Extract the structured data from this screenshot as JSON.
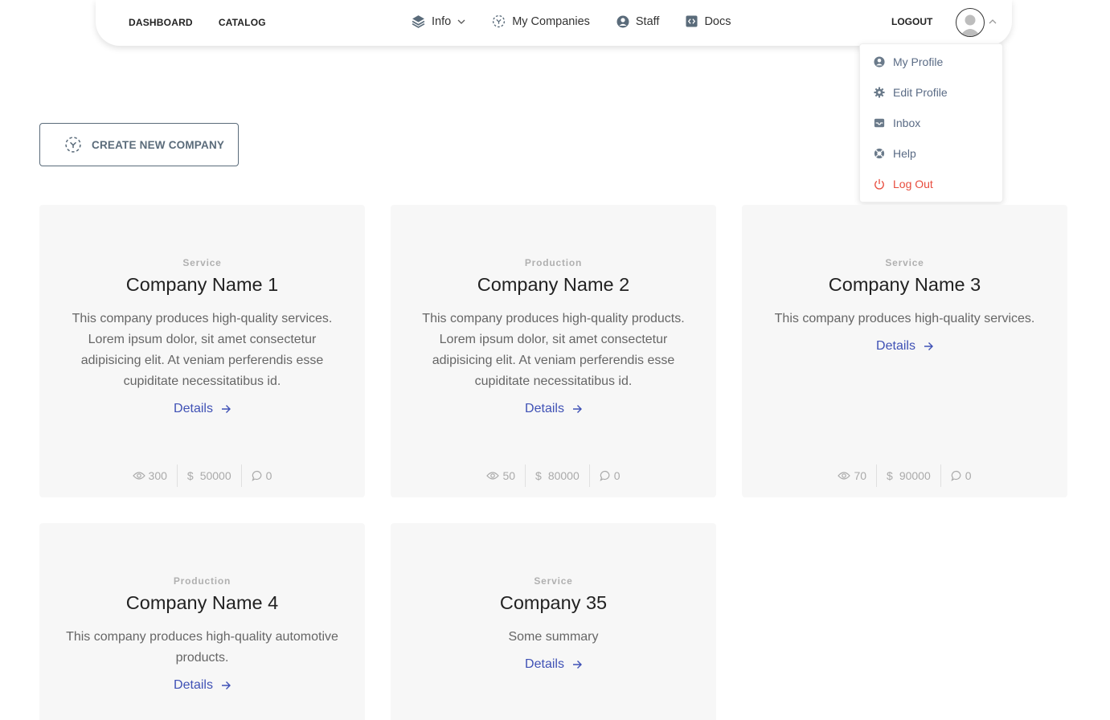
{
  "nav": {
    "dashboard": "DASHBOARD",
    "catalog": "CATALOG",
    "info": "Info",
    "my_companies": "My Companies",
    "staff": "Staff",
    "docs": "Docs",
    "logout": "LOGOUT"
  },
  "dropdown": {
    "items": [
      "My Profile",
      "Edit Profile",
      "Inbox",
      "Help",
      "Log Out"
    ]
  },
  "create_button": "CREATE NEW COMPANY",
  "cards": [
    {
      "category": "Service",
      "title": "Company Name 1",
      "desc": "This company produces high-quality services. Lorem ipsum dolor, sit amet consectetur adipisicing elit. At veniam perferendis esse cupiditate necessitatibus id.",
      "details": "Details",
      "views": "300",
      "price": "50000",
      "comments": "0"
    },
    {
      "category": "Production",
      "title": "Company Name 2",
      "desc": "This company produces high-quality products. Lorem ipsum dolor, sit amet consectetur adipisicing elit. At veniam perferendis esse cupiditate necessitatibus id.",
      "details": "Details",
      "views": "50",
      "price": "80000",
      "comments": "0"
    },
    {
      "category": "Service",
      "title": "Company Name 3",
      "desc": "This company produces high-quality services.",
      "details": "Details",
      "views": "70",
      "price": "90000",
      "comments": "0"
    },
    {
      "category": "Production",
      "title": "Company Name 4",
      "desc": "This company produces high-quality automotive products.",
      "details": "Details"
    },
    {
      "category": "Service",
      "title": "Company 35",
      "desc": "Some summary",
      "details": "Details"
    }
  ],
  "colors": {
    "accent": "#3f51b5",
    "logout": "#e84c3d",
    "card_bg": "#f7f7f7"
  }
}
